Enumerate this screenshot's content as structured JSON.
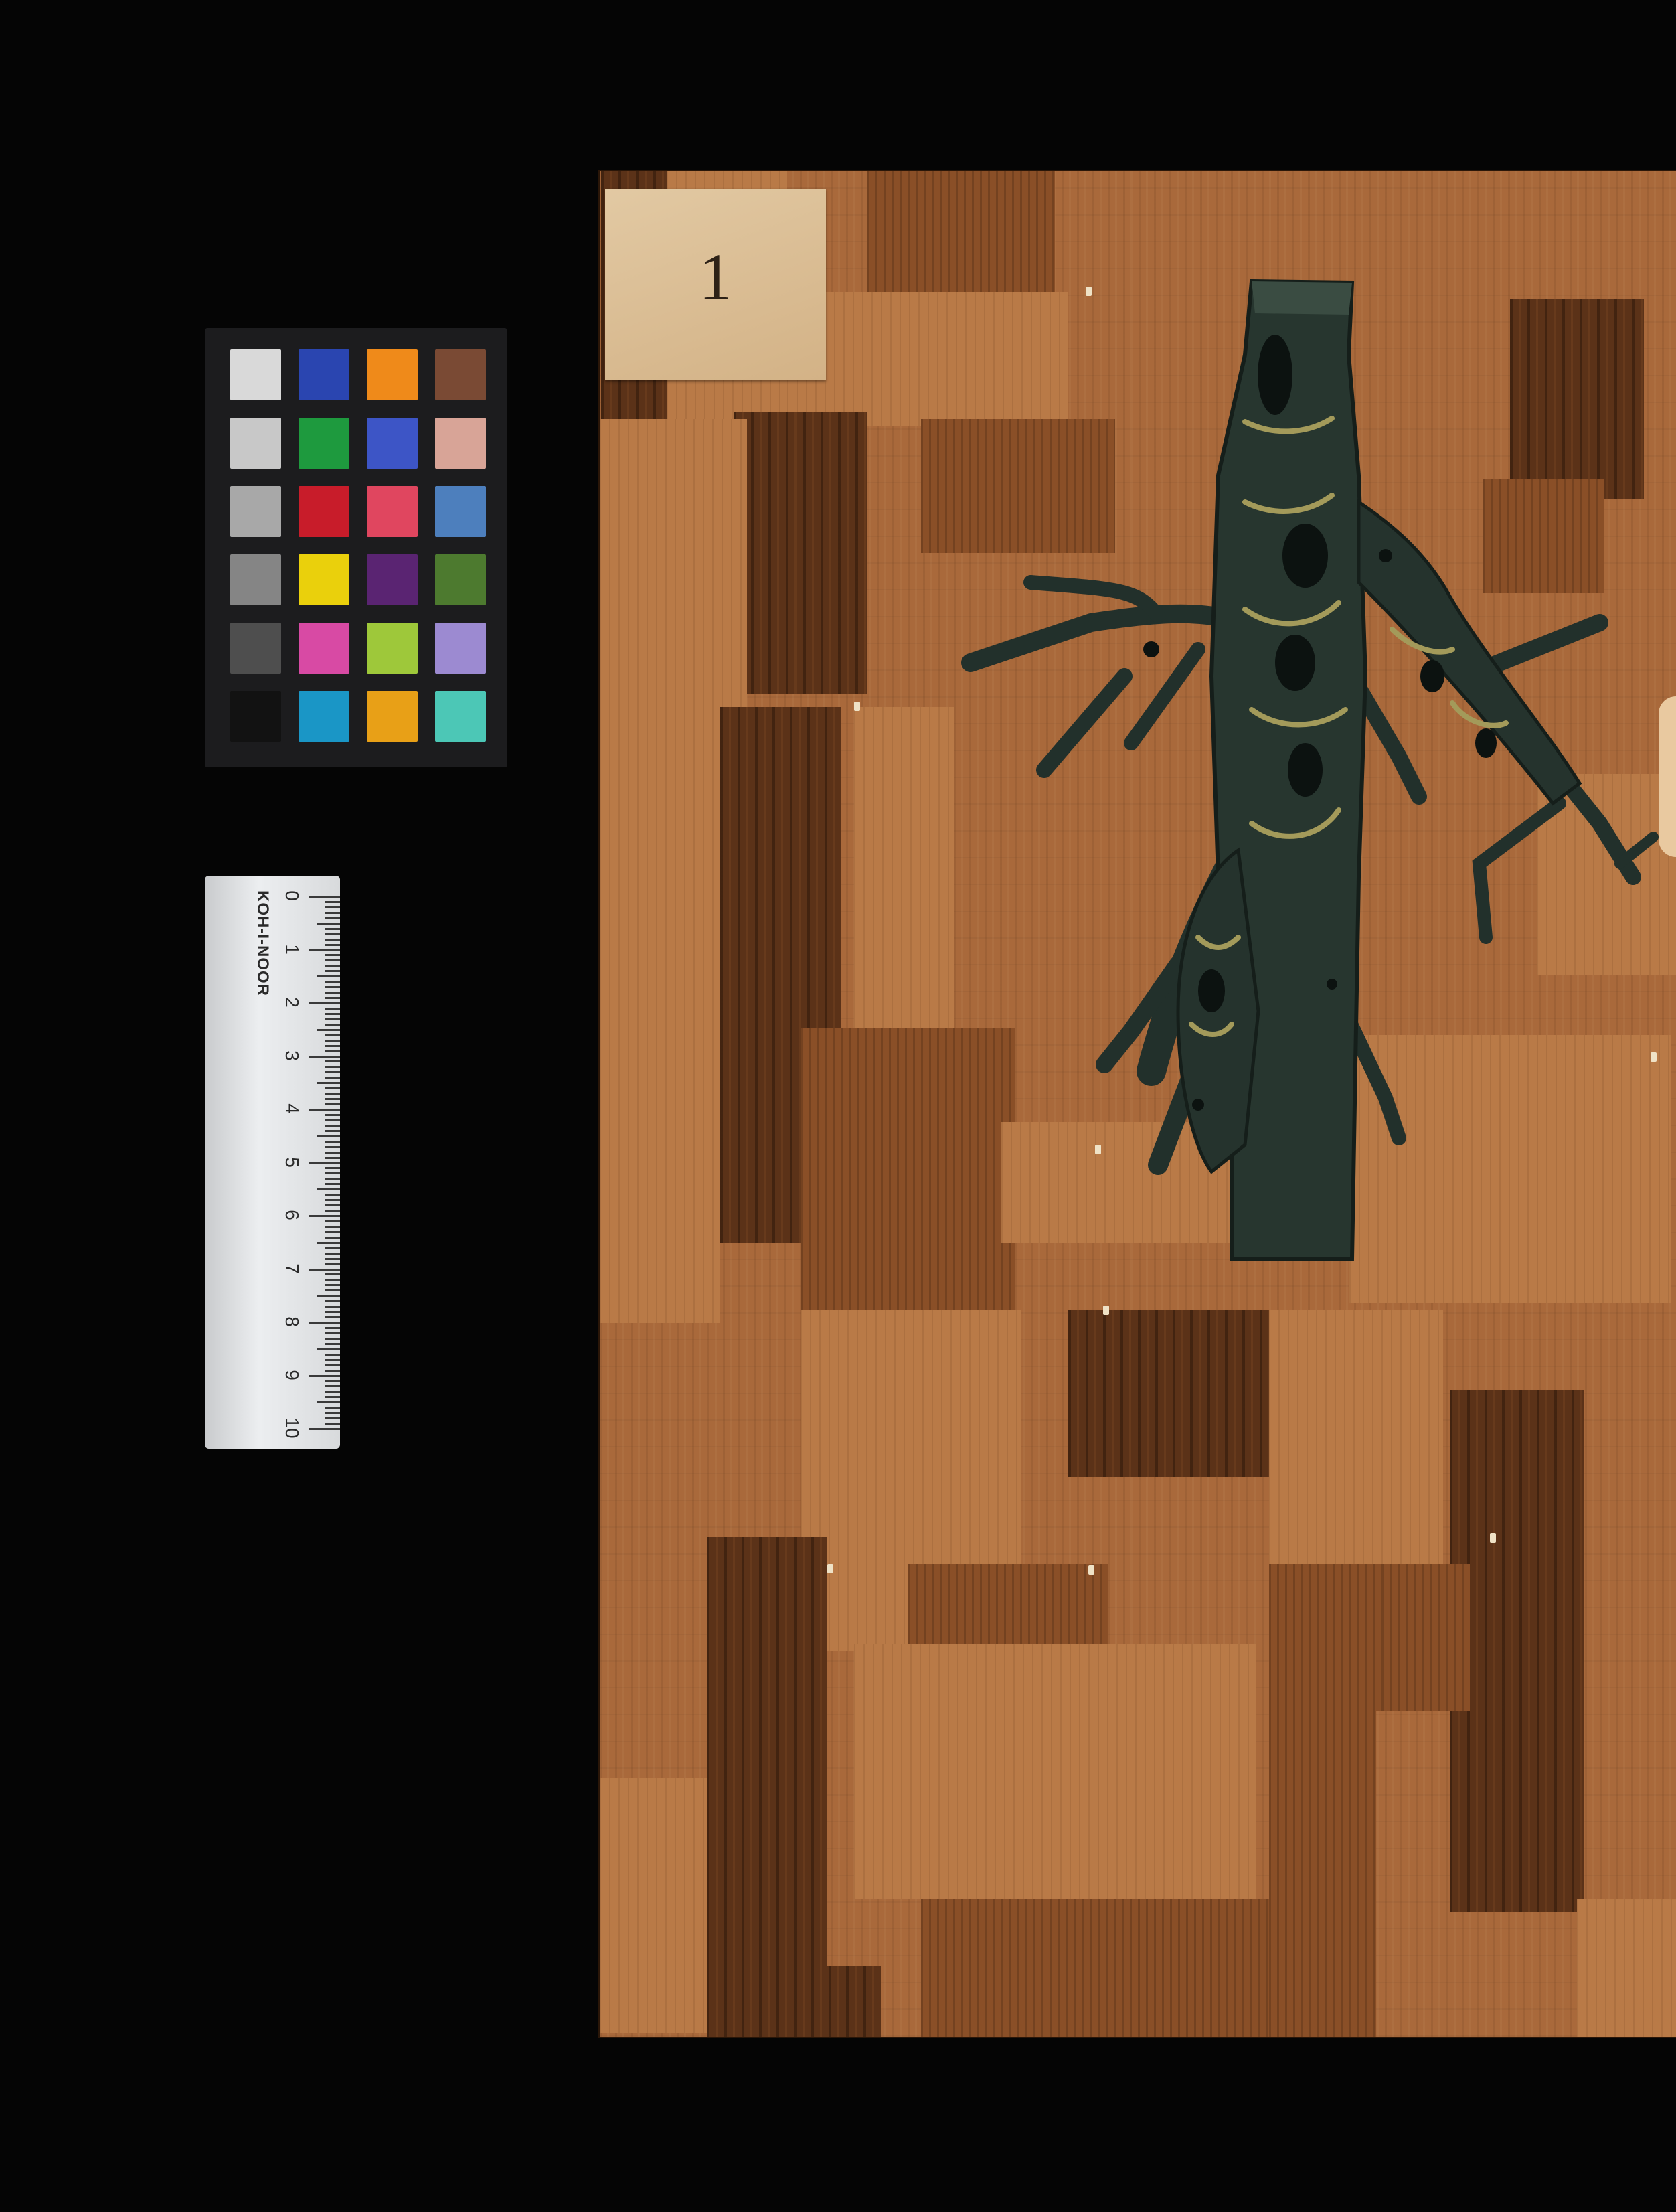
{
  "label": {
    "text": "1"
  },
  "ruler": {
    "brand": "KOH-I-NOOR",
    "numbers": [
      "0",
      "1",
      "2",
      "3",
      "4",
      "5",
      "6",
      "7",
      "8",
      "9",
      "10"
    ]
  },
  "color_checker": {
    "patches": [
      "#d9d9d9",
      "#2a45b0",
      "#ef8a1a",
      "#7a4a34",
      "#c8c8c8",
      "#1e9a3e",
      "#3d55c6",
      "#d8a497",
      "#a8a8a8",
      "#c81c2a",
      "#e0465f",
      "#4d7fbd",
      "#858585",
      "#ead00c",
      "#5a2472",
      "#4d7a2f",
      "#4e4e4e",
      "#d84aa4",
      "#9ec83a",
      "#9c8ad1",
      "#121212",
      "#1a96c6",
      "#e8a017",
      "#4cc7b6"
    ]
  },
  "colors": {
    "background": "#050505",
    "wood": "#a9693b",
    "bronze": "#2a3a33",
    "bronze_highlight": "#a39a5a"
  }
}
